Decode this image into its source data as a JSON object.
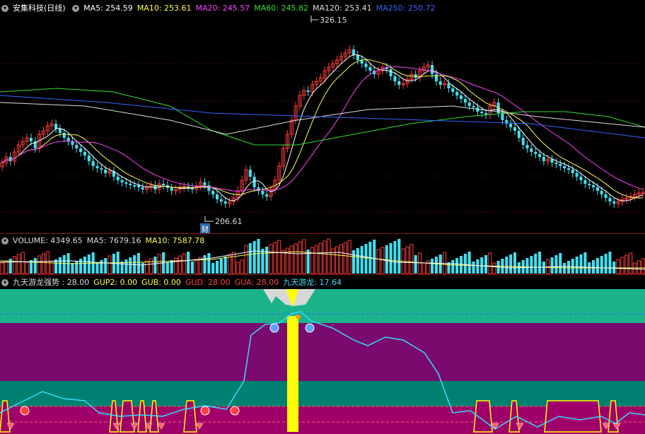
{
  "price_panel": {
    "stock_name": "安集科技(日线)",
    "legend": [
      {
        "label": "MA5: 254.59",
        "color": "#ffffff"
      },
      {
        "label": "MA10: 253.61",
        "color": "#ffff55"
      },
      {
        "label": "MA20: 245.57",
        "color": "#ff44ff"
      },
      {
        "label": "MA60: 245.82",
        "color": "#33dd33"
      },
      {
        "label": "MA120: 253.41",
        "color": "#dddddd"
      },
      {
        "label": "MA250: 250.72",
        "color": "#3366ff"
      }
    ],
    "high_label": "326.15",
    "low_label": "206.61",
    "cai_badge": "财"
  },
  "volume_panel": {
    "legend": [
      {
        "label": "VOLUME: 4349.65",
        "color": "#dddddd"
      },
      {
        "label": "MA5: 7679.16",
        "color": "#dddddd"
      },
      {
        "label": "MA10: 7587.78",
        "color": "#ffff55"
      }
    ]
  },
  "indicator_panel": {
    "legend": [
      {
        "label": "九天游龙强势 : 28.00",
        "color": "#dddddd"
      },
      {
        "label": "GUP2: 0.00",
        "color": "#ffff55"
      },
      {
        "label": "GUB: 0.00",
        "color": "#ffff55"
      },
      {
        "label": "GUD: 28.00",
        "color": "#ff4444"
      },
      {
        "label": "GUA: 28.00",
        "color": "#ff4444"
      },
      {
        "label": "九天游龙: 17.64",
        "color": "#44ddff"
      }
    ]
  },
  "colors": {
    "up": "#ff3b3b",
    "down": "#40e0f0",
    "grid": "#7a1010",
    "teal_band": "#1ab38a",
    "purple_band": "#7a0a6e",
    "green_band": "#008070",
    "magenta_band": "#a0006a",
    "spike": "#ffff00"
  }
}
